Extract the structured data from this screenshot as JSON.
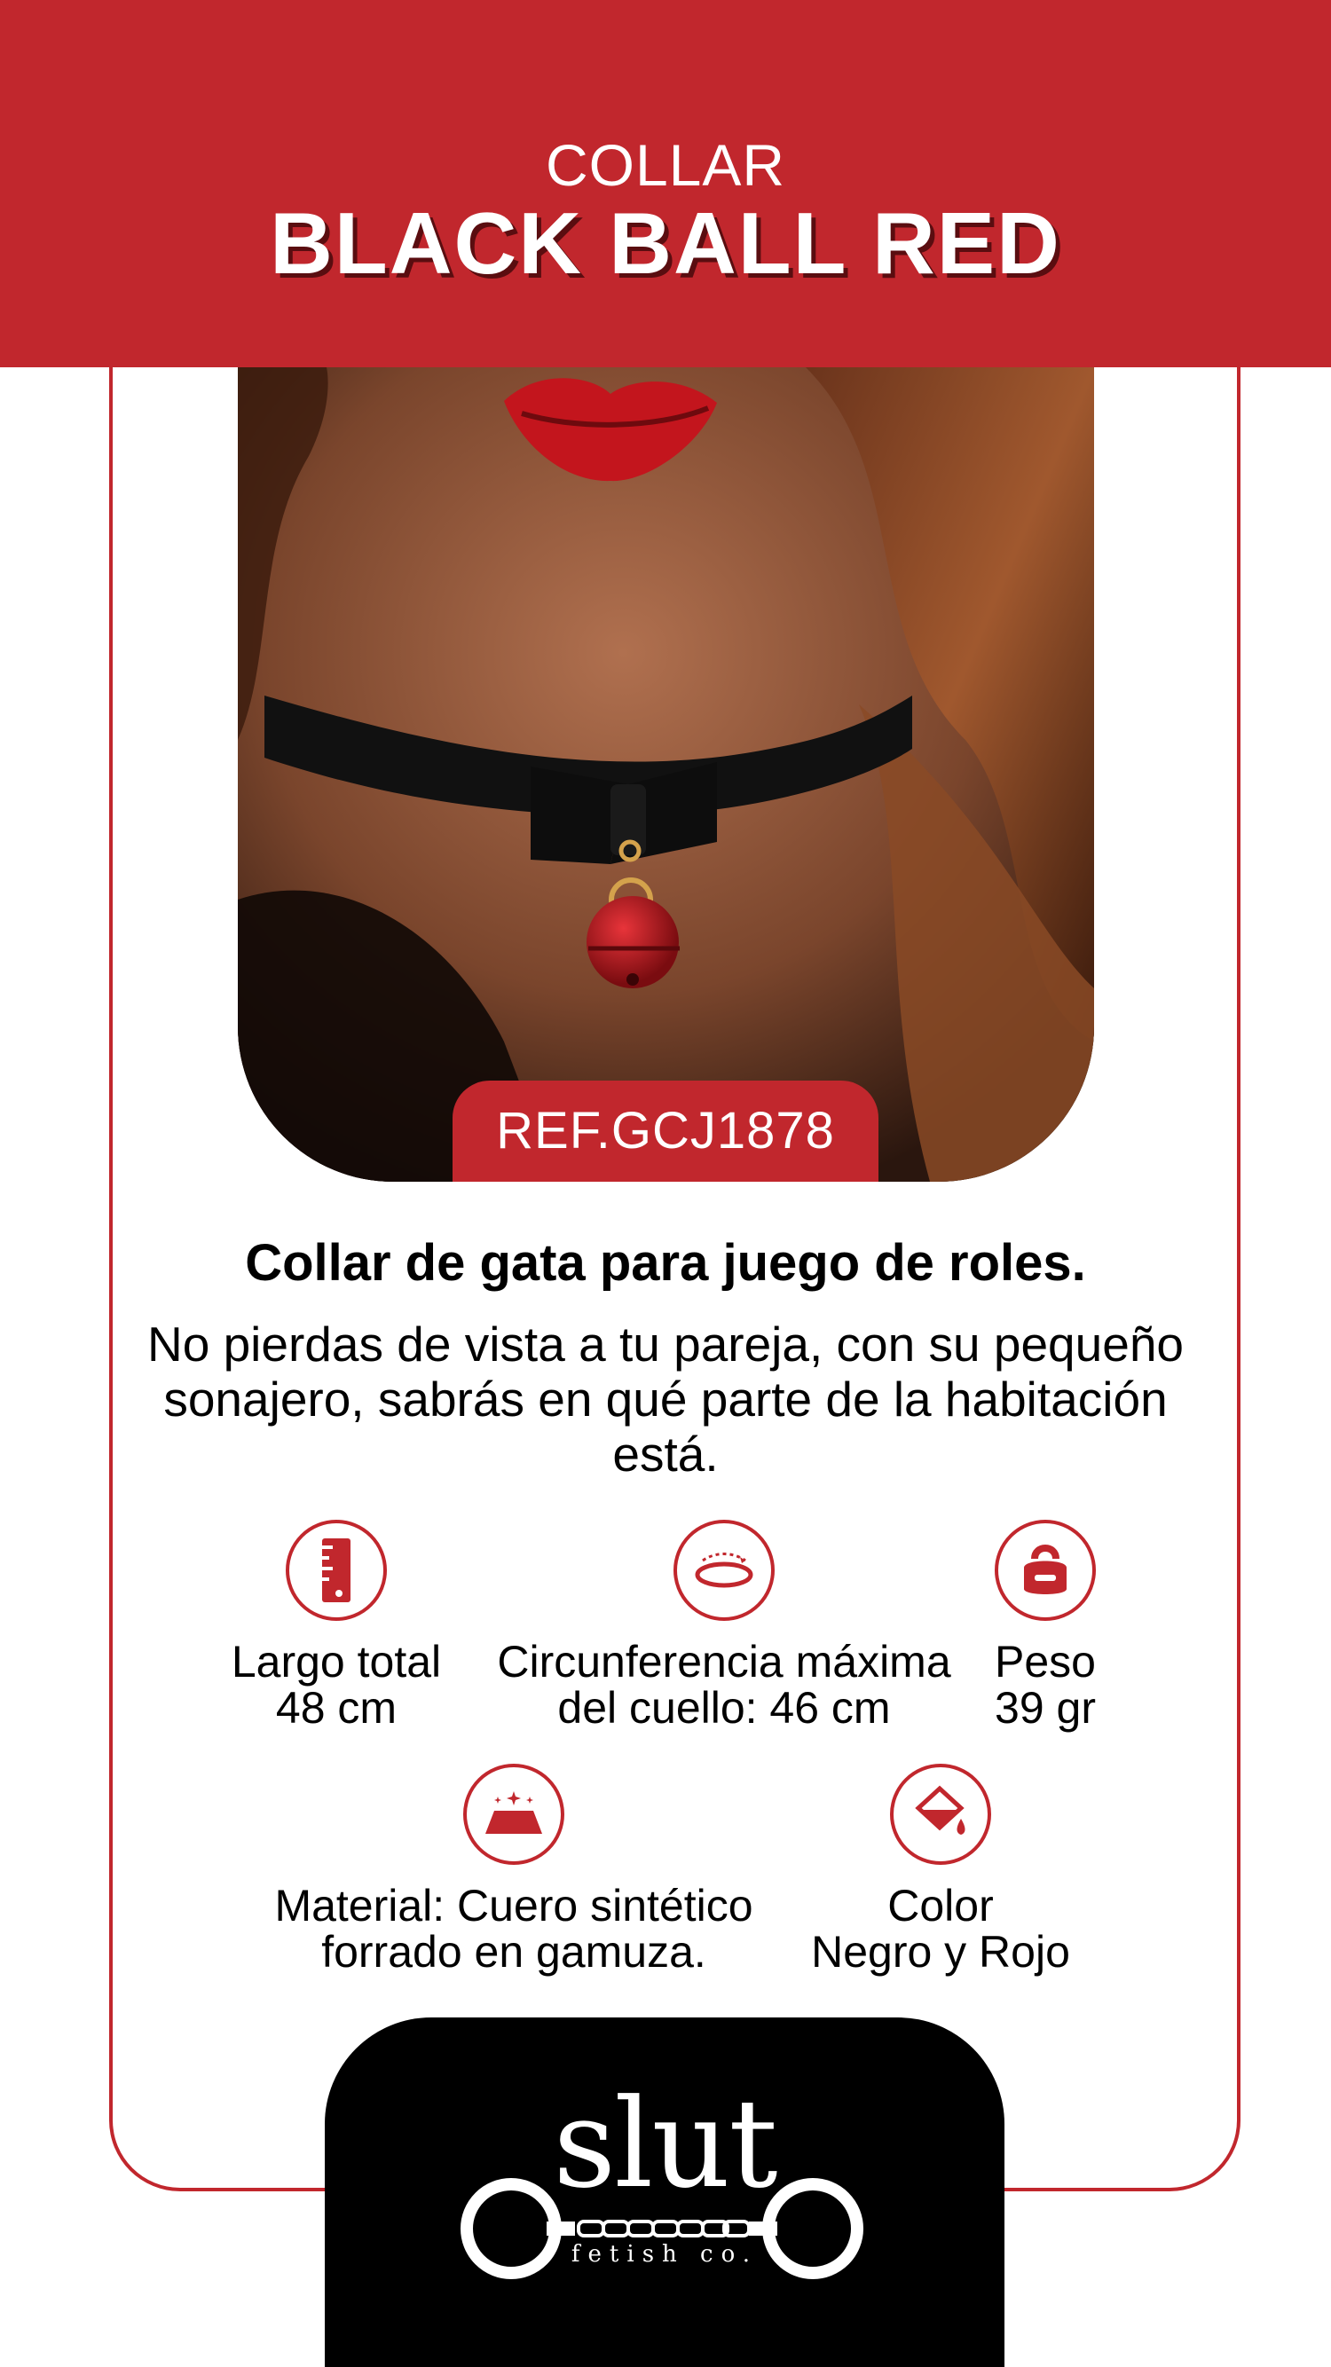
{
  "header": {
    "subtitle": "COLLAR",
    "title": "BLACK BALL RED"
  },
  "product": {
    "ref": "REF.GCJ1878",
    "tagline": "Collar de gata para juego de roles.",
    "description": "No pierdas de vista a tu pareja, con su pequeño sonajero, sabrás en qué parte de la habitación está."
  },
  "features": [
    {
      "icon": "ruler-icon",
      "label": "Largo total",
      "value": "48 cm"
    },
    {
      "icon": "circumference-icon",
      "label": "Circunferencia máxima",
      "value": "del cuello: 46 cm"
    },
    {
      "icon": "weight-icon",
      "label": "Peso",
      "value": "39 gr"
    },
    {
      "icon": "material-icon",
      "label": "Material: Cuero sintético",
      "value": "forrado en gamuza."
    },
    {
      "icon": "paint-bucket-icon",
      "label": "Color",
      "value": "Negro y Rojo"
    }
  ],
  "brand": {
    "name": "slut",
    "tagline": "fetish co."
  },
  "colors": {
    "accent": "#c1272d",
    "dark": "#000000",
    "text": "#000000"
  }
}
